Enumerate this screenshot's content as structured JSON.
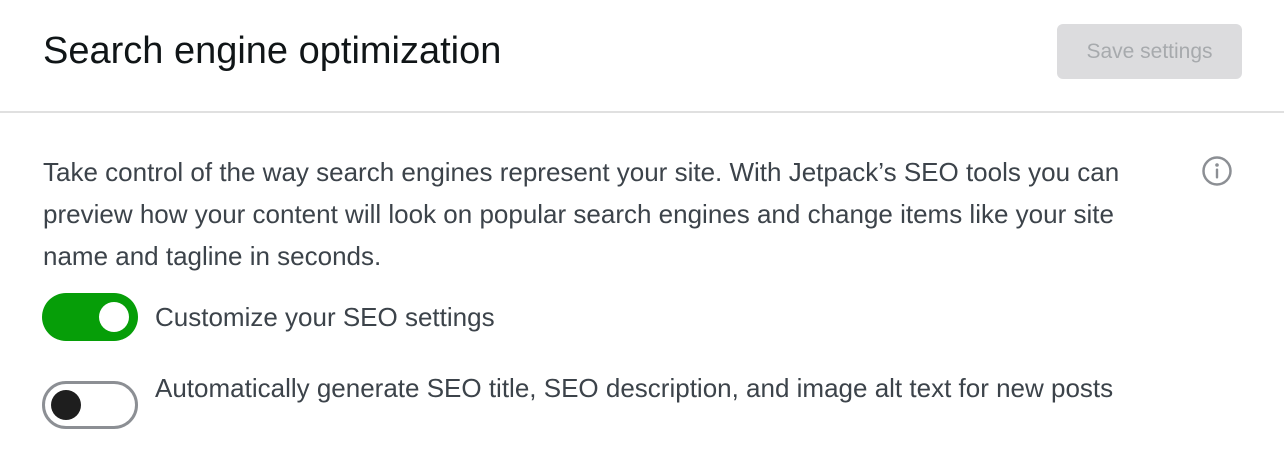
{
  "header": {
    "title": "Search engine optimization",
    "save_label": "Save settings"
  },
  "main": {
    "description": "Take control of the way search engines represent your site. With Jetpack’s SEO tools you can preview how your content will look on popular search engines and change items like your site name and tagline in seconds.",
    "info_icon": "info-icon",
    "toggles": [
      {
        "label": "Customize your SEO settings",
        "checked": true
      },
      {
        "label": "Automatically generate SEO title, SEO description, and image alt text for new posts",
        "checked": false
      }
    ]
  },
  "colors": {
    "toggle_on": "#069e08",
    "toggle_off_border": "#8c8f94",
    "button_disabled_bg": "#dcdcde",
    "button_disabled_text": "#a7aaad"
  }
}
